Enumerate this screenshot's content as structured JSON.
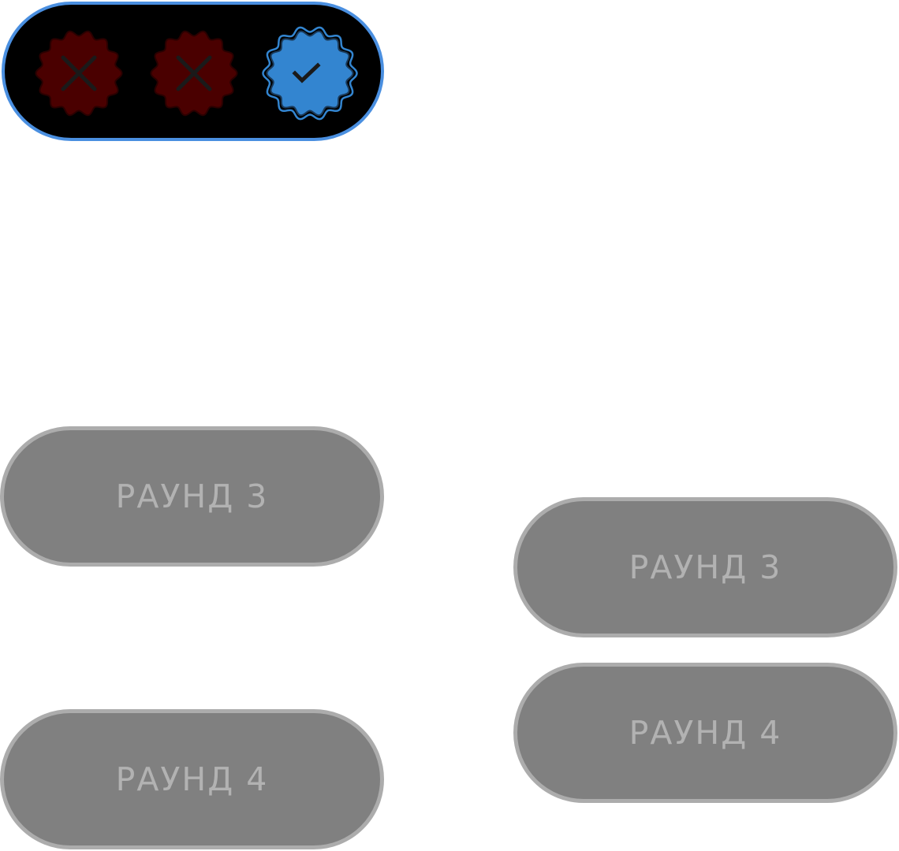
{
  "status": {
    "attempts": [
      {
        "state": "failed",
        "icon": "cross-icon"
      },
      {
        "state": "failed",
        "icon": "cross-icon"
      },
      {
        "state": "passed",
        "icon": "check-icon"
      }
    ],
    "colors": {
      "failed": "#4a0000",
      "passed": "#3385d0",
      "border": "#4a8fe0"
    }
  },
  "rounds": {
    "left": {
      "round3_label": "РАУНД 3",
      "round4_label": "РАУНД 4"
    },
    "right": {
      "round3_label": "РАУНД 3",
      "round4_label": "РАУНД 4"
    }
  },
  "colors": {
    "button_fill": "#808080",
    "button_border": "#acacac",
    "button_text": "#b2b2b2"
  }
}
